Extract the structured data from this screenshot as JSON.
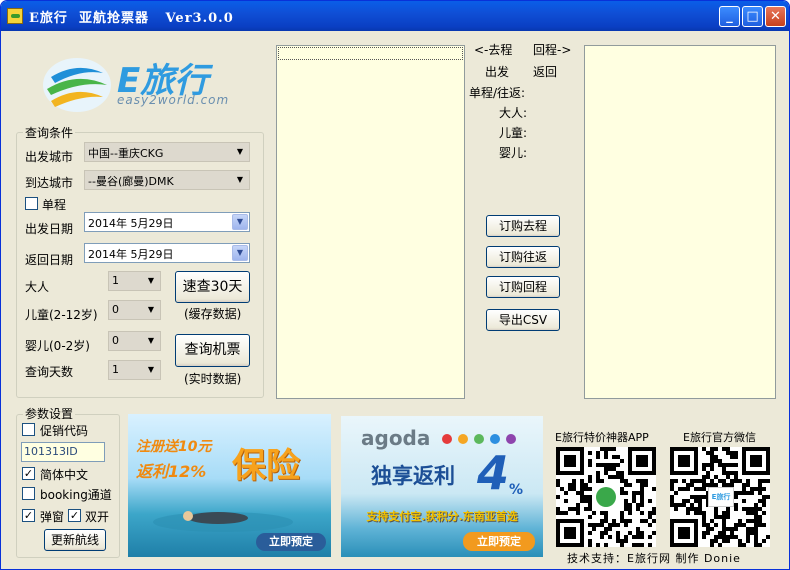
{
  "window": {
    "title": "E旅行  亚航抢票器   Ver3.0.0",
    "controls": {
      "minimize": "_",
      "maximize": "□",
      "close": "✕"
    }
  },
  "logo": {
    "brand": "E旅行",
    "domain": "easy2world.com"
  },
  "query": {
    "legend": "查询条件",
    "depart_city_label": "出发城市",
    "depart_city_value": "中国--重庆CKG",
    "arrive_city_label": "到达城市",
    "arrive_city_value": "--曼谷(廊曼)DMK",
    "oneway_label": "单程",
    "depart_date_label": "出发日期",
    "depart_date_value": "2014年 5月29日",
    "return_date_label": "返回日期",
    "return_date_value": "2014年 5月29日",
    "adult_label": "大人",
    "adult_value": "1",
    "child_label": "儿童(2-12岁)",
    "child_value": "0",
    "infant_label": "婴儿(0-2岁)",
    "infant_value": "0",
    "days_label": "查询天数",
    "days_value": "1",
    "quick30_label": "速查30天",
    "quick30_note": "(缓存数据)",
    "query_label": "查询机票",
    "query_note": "(实时数据)"
  },
  "info": {
    "outbound": "<-去程",
    "return": "回程->",
    "depart": "出发",
    "back": "返回",
    "trip_type": "单程/往返:",
    "adult": "大人:",
    "child": "儿童:",
    "infant": "婴儿:"
  },
  "actions": {
    "buy_outbound": "订购去程",
    "buy_round": "订购往返",
    "buy_return": "订购回程",
    "export_csv": "导出CSV"
  },
  "params": {
    "legend": "参数设置",
    "promo_code_label": "促销代码",
    "promo_code_value": "101313ID",
    "simplified_label": "简体中文",
    "booking_label": "booking通道",
    "popup_label": "弹窗",
    "dual_label": "双开",
    "update_routes_label": "更新航线"
  },
  "ads": {
    "insurance": {
      "line1": "注册送10元",
      "line2": "返利12%",
      "big": "保险",
      "cta": "立即预定"
    },
    "agoda": {
      "brand": "agoda",
      "line1": "独享返利",
      "num": "4",
      "pct": "%",
      "tagline": "支持支付宝.获积分.东南亚首选",
      "cta": "立即预定"
    }
  },
  "qr": {
    "app_label": "E旅行特价神器APP",
    "wechat_label": "E旅行官方微信",
    "wechat_logo": "E旅行"
  },
  "footer": {
    "credits": "技术支持：E旅行网 制作 Donie"
  },
  "colors": {
    "panel_bg": "#ffffe1",
    "accent": "#2f9be0",
    "titlebar": "#0a4fd6"
  }
}
